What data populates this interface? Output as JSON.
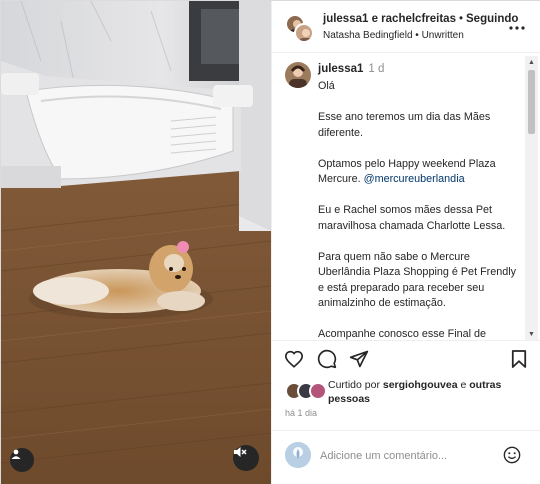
{
  "post": {
    "header": {
      "users": "julessa1 e rachelcfreitas",
      "separator": "•",
      "following": "Seguindo",
      "audio": "Natasha Bedingfield • Unwritten"
    },
    "caption": {
      "username": "julessa1",
      "time": "1 d",
      "paragraphs": [
        "Olá",
        "Esse ano teremos um dia das Mães diferente.",
        "Optamos pelo Happy weekend Plaza Mercure.",
        "Eu e Rachel somos mães dessa Pet maravilhosa chamada Charlotte Lessa.",
        "Para quem não sabe o Mercure Uberlândia Plaza Shopping é Pet Frendly e está preparado para receber seu animalzinho de estimação.",
        "Acompanhe conosco esse Final de semana inesquecível com"
      ],
      "mention": "@mercureuberlandia"
    },
    "likes": {
      "prefix": "Curtido por",
      "user": "sergiohgouvea",
      "middle": "e",
      "others": "outras pessoas"
    },
    "timestamp": "há 1 dia",
    "comment_placeholder": "Adicione um comentário..."
  },
  "icons": {
    "more": "more-horizontal-icon",
    "like": "heart-icon",
    "comment": "comment-icon",
    "share": "share-icon",
    "save": "bookmark-icon",
    "emoji": "emoji-icon",
    "user_tag": "user-tag-icon",
    "mute": "speaker-muted-icon"
  },
  "colors": {
    "text": "#262626",
    "muted": "#8e8e8e",
    "link": "#00376b",
    "border": "#efefef"
  }
}
